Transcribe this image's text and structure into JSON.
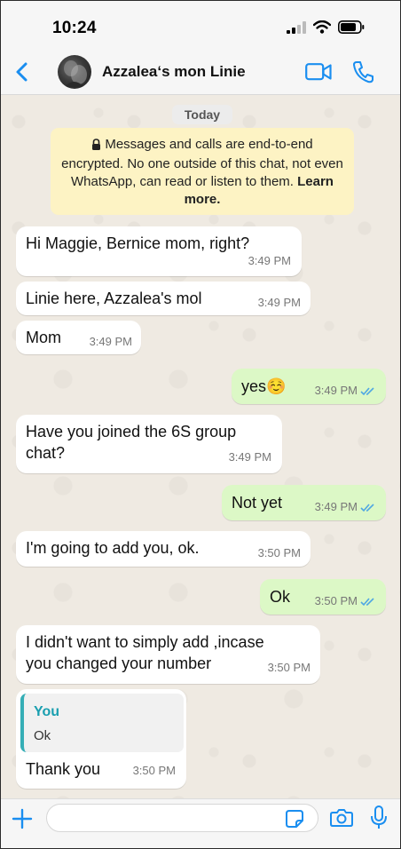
{
  "status_bar": {
    "time": "10:24"
  },
  "header": {
    "contact_name": "Azzalea‘s mon Linie"
  },
  "chat": {
    "date_label": "Today",
    "encryption_notice": {
      "text": "Messages and calls are end-to-end encrypted. No one outside of this chat, not even WhatsApp, can read or listen to them. ",
      "link": "Learn more."
    },
    "messages": [
      {
        "direction": "incoming",
        "text": "Hi Maggie, Bernice mom, right?",
        "time": "3:49 PM"
      },
      {
        "direction": "incoming",
        "text": "Linie here, Azzalea's mol",
        "time": "3:49 PM"
      },
      {
        "direction": "incoming",
        "text": "Mom",
        "time": "3:49 PM"
      },
      {
        "direction": "outgoing",
        "text": "yes☺️",
        "time": "3:49 PM",
        "status": "read"
      },
      {
        "direction": "incoming",
        "text": "Have you joined the 6S group\nchat?",
        "time": "3:49 PM"
      },
      {
        "direction": "outgoing",
        "text": "Not yet",
        "time": "3:49 PM",
        "status": "read"
      },
      {
        "direction": "incoming",
        "text": "I'm going to add you, ok.",
        "time": "3:50 PM"
      },
      {
        "direction": "outgoing",
        "text": "Ok",
        "time": "3:50 PM",
        "status": "read"
      },
      {
        "direction": "incoming",
        "text": "I didn't want to simply add ,incase\nyou changed your number",
        "time": "3:50 PM"
      },
      {
        "direction": "incoming",
        "text": "Thank you",
        "time": "3:50 PM",
        "quote": {
          "author": "You",
          "text": "Ok"
        }
      }
    ]
  },
  "input_bar": {
    "placeholder": ""
  },
  "icons": {
    "back": "chevron-left-icon",
    "video": "video-camera-icon",
    "phone": "phone-icon",
    "plus": "plus-icon",
    "sticker": "sticker-icon",
    "camera": "camera-icon",
    "mic": "microphone-icon"
  },
  "colors": {
    "accent": "#1a8ef0",
    "outgoing_bubble": "#dcf8c6",
    "incoming_bubble": "#ffffff",
    "notice_bg": "#fdf3c4",
    "read_ticks": "#4fa7e3",
    "quote_accent": "#35aeb6"
  }
}
